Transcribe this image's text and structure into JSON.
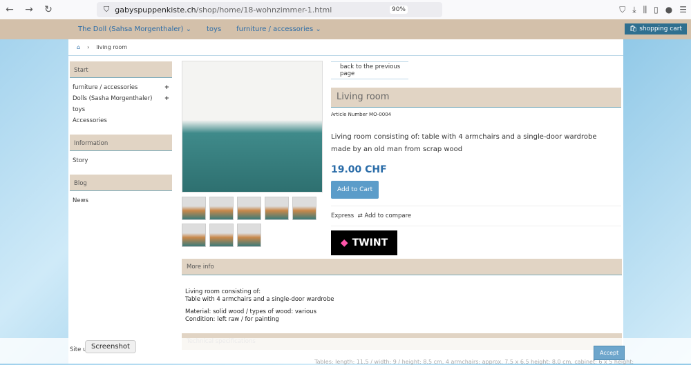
{
  "browser": {
    "host": "gabyspuppenkiste.ch",
    "path": "/shop/home/18-wohnzimmer-1.html",
    "zoom": "90%"
  },
  "topnav": {
    "items": [
      "The Doll (Sahsa Morgenthaler) ⌄",
      "toys",
      "furniture / accessories ⌄"
    ],
    "cart": "shopping cart"
  },
  "breadcrumb": {
    "current": "living room"
  },
  "sidebar": {
    "start": "Start",
    "start_items": [
      {
        "label": "furniture / accessories",
        "plus": "+"
      },
      {
        "label": "Dolls (Sasha Morgenthaler)",
        "plus": "+"
      },
      {
        "label": "toys",
        "plus": ""
      },
      {
        "label": "Accessories",
        "plus": ""
      }
    ],
    "info": "Information",
    "info_items": [
      "Story"
    ],
    "blog": "Blog",
    "blog_items": [
      "News"
    ]
  },
  "product": {
    "back": "back to the previous page",
    "title": "Living room",
    "article": "Article Number MO-0004",
    "desc1": "Living room consisting of: table with 4 armchairs and a single-door wardrobe",
    "desc2": "made by an old man from scrap wood",
    "price": "19.00 CHF",
    "add": "Add to Cart",
    "express": "Express",
    "compare": "Add to compare",
    "twint": "TWINT"
  },
  "more": {
    "title": "More info",
    "l1": "Living room consisting of:",
    "l2": "Table with 4 armchairs and a single-door wardrobe",
    "l3": "Material: solid wood / types of wood: various",
    "l4": "Condition: left raw / for painting"
  },
  "tech": {
    "title": "Technical specifications",
    "dims": "Tables: length: 11.5 / width: 9 / height: 8.5 cm, 4 armchairs: approx. 7.5 x 6.5 height: 8.0 cm, cabinet: 6 x 5 height:"
  },
  "cookie": {
    "text": "Site u",
    "accept": "Accept",
    "tooltip": "Screenshot"
  }
}
